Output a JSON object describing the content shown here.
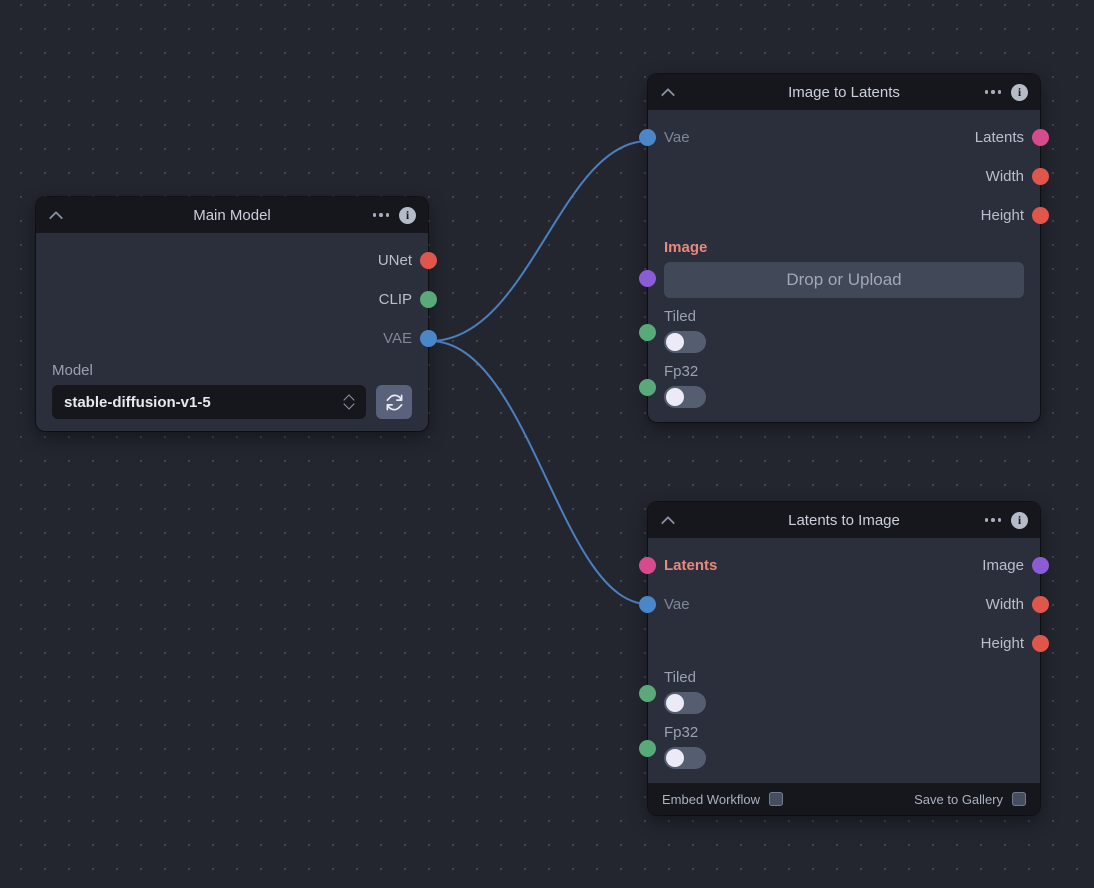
{
  "canvas": {
    "background_color": "#23262f",
    "grid_dot_color": "#4a4f5e"
  },
  "palette": {
    "socket_unet": "#e0554c",
    "socket_clip": "#59a97a",
    "socket_vae": "#4a86c8",
    "socket_latents": "#d64a8e",
    "socket_image": "#8c5cd6",
    "socket_scalar": "#e0554c",
    "socket_boolean": "#59a97a",
    "edge_color": "#4a7fc0",
    "required_label": "#e8897d"
  },
  "nodes": [
    {
      "id": "main-model",
      "title": "Main Model",
      "header": {
        "collapse_icon": "chevron-up-icon",
        "menu_icon": "dots-menu-icon",
        "info_icon": "info-icon"
      },
      "outputs": [
        {
          "label": "UNet",
          "color": "#e0554c",
          "connected": false
        },
        {
          "label": "CLIP",
          "color": "#59a97a",
          "connected": false
        },
        {
          "label": "VAE",
          "color": "#4a86c8",
          "connected": true
        }
      ],
      "fields": [
        {
          "type": "model-select",
          "label": "Model",
          "value": "stable-diffusion-v1-5",
          "stepper_icon": "chevron-updown-icon",
          "refresh_icon": "refresh-icon"
        }
      ]
    },
    {
      "id": "image-to-latents",
      "title": "Image to Latents",
      "header": {
        "collapse_icon": "chevron-up-icon",
        "menu_icon": "dots-menu-icon",
        "info_icon": "info-icon"
      },
      "inputs": [
        {
          "label": "Vae",
          "color": "#4a86c8",
          "connected": true,
          "required": false
        },
        {
          "label": "Image",
          "color": "#8c5cd6",
          "connected": false,
          "required": true
        },
        {
          "label": "Tiled",
          "color": "#59a97a",
          "connected": false,
          "required": false
        },
        {
          "label": "Fp32",
          "color": "#59a97a",
          "connected": false,
          "required": false
        }
      ],
      "outputs": [
        {
          "label": "Latents",
          "color": "#d64a8e",
          "connected": false
        },
        {
          "label": "Width",
          "color": "#e0554c",
          "connected": false
        },
        {
          "label": "Height",
          "color": "#e0554c",
          "connected": false
        }
      ],
      "fields": [
        {
          "type": "dropzone",
          "label": "Image",
          "required": true,
          "placeholder": "Drop or Upload"
        },
        {
          "type": "toggle",
          "label": "Tiled",
          "value": false
        },
        {
          "type": "toggle",
          "label": "Fp32",
          "value": false
        }
      ]
    },
    {
      "id": "latents-to-image",
      "title": "Latents to Image",
      "header": {
        "collapse_icon": "chevron-up-icon",
        "menu_icon": "dots-menu-icon",
        "info_icon": "info-icon"
      },
      "inputs": [
        {
          "label": "Latents",
          "color": "#d64a8e",
          "connected": false,
          "required": true
        },
        {
          "label": "Vae",
          "color": "#4a86c8",
          "connected": true,
          "required": false
        },
        {
          "label": "Tiled",
          "color": "#59a97a",
          "connected": false,
          "required": false
        },
        {
          "label": "Fp32",
          "color": "#59a97a",
          "connected": false,
          "required": false
        }
      ],
      "outputs": [
        {
          "label": "Image",
          "color": "#8c5cd6",
          "connected": false
        },
        {
          "label": "Width",
          "color": "#e0554c",
          "connected": false
        },
        {
          "label": "Height",
          "color": "#e0554c",
          "connected": false
        }
      ],
      "fields": [
        {
          "type": "toggle",
          "label": "Tiled",
          "value": false
        },
        {
          "type": "toggle",
          "label": "Fp32",
          "value": false
        }
      ],
      "footer": [
        {
          "label": "Embed Workflow",
          "checked": false
        },
        {
          "label": "Save to Gallery",
          "checked": false
        }
      ]
    }
  ],
  "edges": [
    {
      "from": "main-model.VAE",
      "to": "image-to-latents.Vae"
    },
    {
      "from": "main-model.VAE",
      "to": "latents-to-image.Vae"
    }
  ]
}
